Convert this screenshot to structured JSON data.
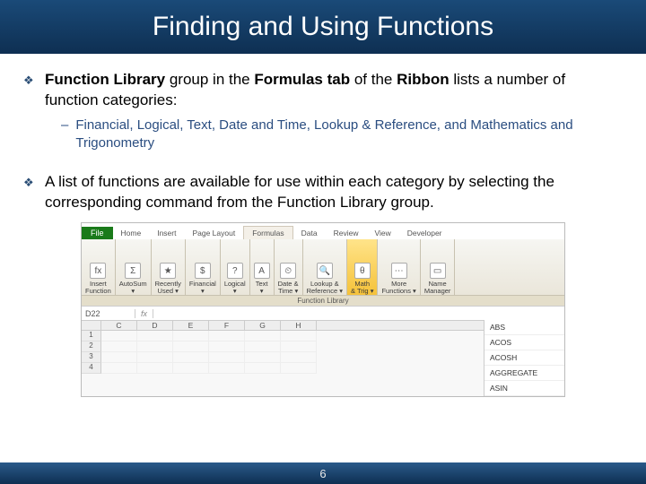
{
  "title": "Finding and Using Functions",
  "bullet1": {
    "b1": "Function Library",
    "t1": " group in the ",
    "b2": "Formulas tab",
    "t2": " of the ",
    "b3": "Ribbon",
    "t3": " lists a number of function categories:"
  },
  "sub1": "Financial, Logical, Text, Date and Time, Lookup & Reference, and Mathematics and Trigonometry",
  "bullet2": "A list of functions are available for use within each category by selecting the corresponding command from the Function Library group.",
  "ribbon": {
    "file": "File",
    "tabs": [
      "Home",
      "Insert",
      "Page Layout",
      "Formulas",
      "Data",
      "Review",
      "View",
      "Developer"
    ],
    "active": 3,
    "groups": [
      {
        "icon": "fx",
        "label": "Insert\nFunction"
      },
      {
        "icon": "Σ",
        "label": "AutoSum\n▾"
      },
      {
        "icon": "★",
        "label": "Recently\nUsed ▾"
      },
      {
        "icon": "$",
        "label": "Financial\n▾"
      },
      {
        "icon": "?",
        "label": "Logical\n▾"
      },
      {
        "icon": "A",
        "label": "Text\n▾"
      },
      {
        "icon": "⏲",
        "label": "Date &\nTime ▾"
      },
      {
        "icon": "🔍",
        "label": "Lookup &\nReference ▾"
      },
      {
        "icon": "θ",
        "label": "Math\n& Trig ▾",
        "hl": true
      },
      {
        "icon": "⋯",
        "label": "More\nFunctions ▾"
      },
      {
        "icon": "▭",
        "label": "Name\nManager"
      }
    ],
    "groupbar": "Function Library",
    "namebox": "D22",
    "fx": "fx",
    "cols": [
      "C",
      "D",
      "E",
      "F",
      "G",
      "H"
    ],
    "rows": [
      "1",
      "2",
      "3",
      "4"
    ],
    "menu": [
      "ABS",
      "ACOS",
      "ACOSH",
      "AGGREGATE",
      "ASIN"
    ]
  },
  "page": "6"
}
